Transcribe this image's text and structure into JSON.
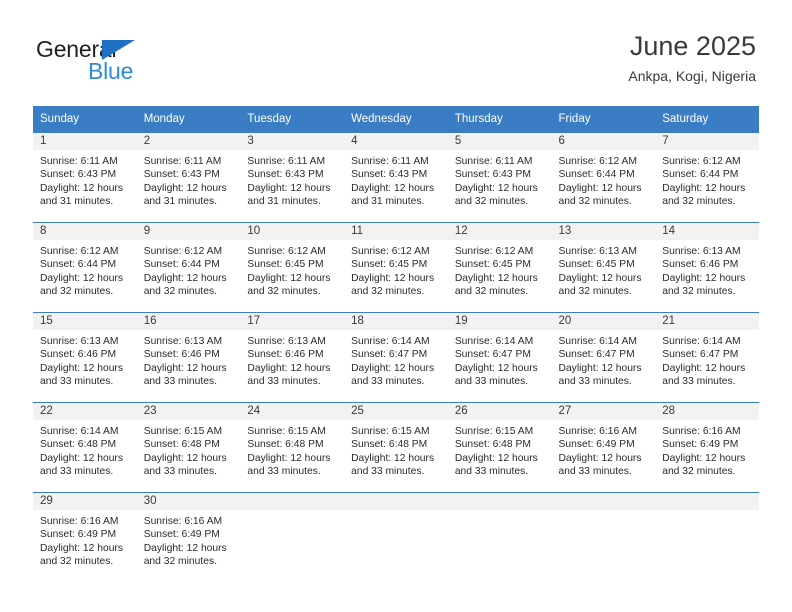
{
  "brand": {
    "name_dark": "General",
    "name_blue": "Blue",
    "accent_dark": "#231f20",
    "accent_blue": "#2e8bd8",
    "triangle_color": "#1f6fc4"
  },
  "header": {
    "title": "June 2025",
    "subtitle": "Ankpa, Kogi, Nigeria"
  },
  "theme": {
    "header_bar": "#3b7dc4",
    "daynum_bg": "#f2f2f2",
    "text": "#2b2b2b"
  },
  "weekdays": [
    "Sunday",
    "Monday",
    "Tuesday",
    "Wednesday",
    "Thursday",
    "Friday",
    "Saturday"
  ],
  "weeks": [
    [
      {
        "day": "1",
        "sunrise": "Sunrise: 6:11 AM",
        "sunset": "Sunset: 6:43 PM",
        "daylight1": "Daylight: 12 hours",
        "daylight2": "and 31 minutes."
      },
      {
        "day": "2",
        "sunrise": "Sunrise: 6:11 AM",
        "sunset": "Sunset: 6:43 PM",
        "daylight1": "Daylight: 12 hours",
        "daylight2": "and 31 minutes."
      },
      {
        "day": "3",
        "sunrise": "Sunrise: 6:11 AM",
        "sunset": "Sunset: 6:43 PM",
        "daylight1": "Daylight: 12 hours",
        "daylight2": "and 31 minutes."
      },
      {
        "day": "4",
        "sunrise": "Sunrise: 6:11 AM",
        "sunset": "Sunset: 6:43 PM",
        "daylight1": "Daylight: 12 hours",
        "daylight2": "and 31 minutes."
      },
      {
        "day": "5",
        "sunrise": "Sunrise: 6:11 AM",
        "sunset": "Sunset: 6:43 PM",
        "daylight1": "Daylight: 12 hours",
        "daylight2": "and 32 minutes."
      },
      {
        "day": "6",
        "sunrise": "Sunrise: 6:12 AM",
        "sunset": "Sunset: 6:44 PM",
        "daylight1": "Daylight: 12 hours",
        "daylight2": "and 32 minutes."
      },
      {
        "day": "7",
        "sunrise": "Sunrise: 6:12 AM",
        "sunset": "Sunset: 6:44 PM",
        "daylight1": "Daylight: 12 hours",
        "daylight2": "and 32 minutes."
      }
    ],
    [
      {
        "day": "8",
        "sunrise": "Sunrise: 6:12 AM",
        "sunset": "Sunset: 6:44 PM",
        "daylight1": "Daylight: 12 hours",
        "daylight2": "and 32 minutes."
      },
      {
        "day": "9",
        "sunrise": "Sunrise: 6:12 AM",
        "sunset": "Sunset: 6:44 PM",
        "daylight1": "Daylight: 12 hours",
        "daylight2": "and 32 minutes."
      },
      {
        "day": "10",
        "sunrise": "Sunrise: 6:12 AM",
        "sunset": "Sunset: 6:45 PM",
        "daylight1": "Daylight: 12 hours",
        "daylight2": "and 32 minutes."
      },
      {
        "day": "11",
        "sunrise": "Sunrise: 6:12 AM",
        "sunset": "Sunset: 6:45 PM",
        "daylight1": "Daylight: 12 hours",
        "daylight2": "and 32 minutes."
      },
      {
        "day": "12",
        "sunrise": "Sunrise: 6:12 AM",
        "sunset": "Sunset: 6:45 PM",
        "daylight1": "Daylight: 12 hours",
        "daylight2": "and 32 minutes."
      },
      {
        "day": "13",
        "sunrise": "Sunrise: 6:13 AM",
        "sunset": "Sunset: 6:45 PM",
        "daylight1": "Daylight: 12 hours",
        "daylight2": "and 32 minutes."
      },
      {
        "day": "14",
        "sunrise": "Sunrise: 6:13 AM",
        "sunset": "Sunset: 6:46 PM",
        "daylight1": "Daylight: 12 hours",
        "daylight2": "and 32 minutes."
      }
    ],
    [
      {
        "day": "15",
        "sunrise": "Sunrise: 6:13 AM",
        "sunset": "Sunset: 6:46 PM",
        "daylight1": "Daylight: 12 hours",
        "daylight2": "and 33 minutes."
      },
      {
        "day": "16",
        "sunrise": "Sunrise: 6:13 AM",
        "sunset": "Sunset: 6:46 PM",
        "daylight1": "Daylight: 12 hours",
        "daylight2": "and 33 minutes."
      },
      {
        "day": "17",
        "sunrise": "Sunrise: 6:13 AM",
        "sunset": "Sunset: 6:46 PM",
        "daylight1": "Daylight: 12 hours",
        "daylight2": "and 33 minutes."
      },
      {
        "day": "18",
        "sunrise": "Sunrise: 6:14 AM",
        "sunset": "Sunset: 6:47 PM",
        "daylight1": "Daylight: 12 hours",
        "daylight2": "and 33 minutes."
      },
      {
        "day": "19",
        "sunrise": "Sunrise: 6:14 AM",
        "sunset": "Sunset: 6:47 PM",
        "daylight1": "Daylight: 12 hours",
        "daylight2": "and 33 minutes."
      },
      {
        "day": "20",
        "sunrise": "Sunrise: 6:14 AM",
        "sunset": "Sunset: 6:47 PM",
        "daylight1": "Daylight: 12 hours",
        "daylight2": "and 33 minutes."
      },
      {
        "day": "21",
        "sunrise": "Sunrise: 6:14 AM",
        "sunset": "Sunset: 6:47 PM",
        "daylight1": "Daylight: 12 hours",
        "daylight2": "and 33 minutes."
      }
    ],
    [
      {
        "day": "22",
        "sunrise": "Sunrise: 6:14 AM",
        "sunset": "Sunset: 6:48 PM",
        "daylight1": "Daylight: 12 hours",
        "daylight2": "and 33 minutes."
      },
      {
        "day": "23",
        "sunrise": "Sunrise: 6:15 AM",
        "sunset": "Sunset: 6:48 PM",
        "daylight1": "Daylight: 12 hours",
        "daylight2": "and 33 minutes."
      },
      {
        "day": "24",
        "sunrise": "Sunrise: 6:15 AM",
        "sunset": "Sunset: 6:48 PM",
        "daylight1": "Daylight: 12 hours",
        "daylight2": "and 33 minutes."
      },
      {
        "day": "25",
        "sunrise": "Sunrise: 6:15 AM",
        "sunset": "Sunset: 6:48 PM",
        "daylight1": "Daylight: 12 hours",
        "daylight2": "and 33 minutes."
      },
      {
        "day": "26",
        "sunrise": "Sunrise: 6:15 AM",
        "sunset": "Sunset: 6:48 PM",
        "daylight1": "Daylight: 12 hours",
        "daylight2": "and 33 minutes."
      },
      {
        "day": "27",
        "sunrise": "Sunrise: 6:16 AM",
        "sunset": "Sunset: 6:49 PM",
        "daylight1": "Daylight: 12 hours",
        "daylight2": "and 33 minutes."
      },
      {
        "day": "28",
        "sunrise": "Sunrise: 6:16 AM",
        "sunset": "Sunset: 6:49 PM",
        "daylight1": "Daylight: 12 hours",
        "daylight2": "and 32 minutes."
      }
    ],
    [
      {
        "day": "29",
        "sunrise": "Sunrise: 6:16 AM",
        "sunset": "Sunset: 6:49 PM",
        "daylight1": "Daylight: 12 hours",
        "daylight2": "and 32 minutes."
      },
      {
        "day": "30",
        "sunrise": "Sunrise: 6:16 AM",
        "sunset": "Sunset: 6:49 PM",
        "daylight1": "Daylight: 12 hours",
        "daylight2": "and 32 minutes."
      },
      {
        "day": "",
        "sunrise": "",
        "sunset": "",
        "daylight1": "",
        "daylight2": ""
      },
      {
        "day": "",
        "sunrise": "",
        "sunset": "",
        "daylight1": "",
        "daylight2": ""
      },
      {
        "day": "",
        "sunrise": "",
        "sunset": "",
        "daylight1": "",
        "daylight2": ""
      },
      {
        "day": "",
        "sunrise": "",
        "sunset": "",
        "daylight1": "",
        "daylight2": ""
      },
      {
        "day": "",
        "sunrise": "",
        "sunset": "",
        "daylight1": "",
        "daylight2": ""
      }
    ]
  ]
}
